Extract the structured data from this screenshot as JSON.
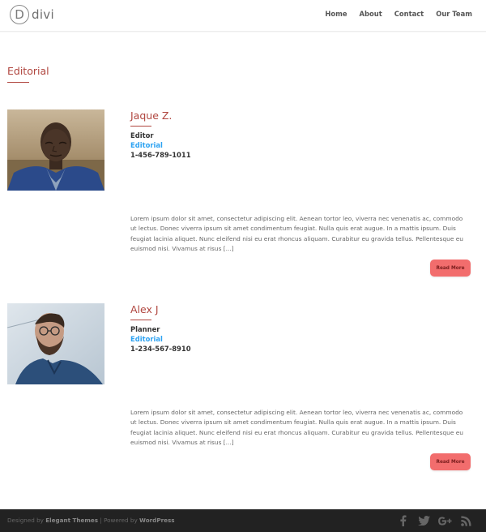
{
  "header": {
    "logo_letter": "D",
    "logo_text": "divi",
    "nav": [
      "Home",
      "About",
      "Contact",
      "Our Team"
    ]
  },
  "section": {
    "title": "Editorial"
  },
  "members": [
    {
      "name": "Jaque Z.",
      "role": "Editor",
      "department": "Editorial",
      "phone": "1-456-789-1011",
      "excerpt": "Lorem ipsum dolor sit amet, consectetur adipiscing elit. Aenean tortor leo, viverra nec venenatis ac, commodo ut lectus. Donec viverra ipsum sit amet condimentum feugiat. Nulla quis erat augue. In a mattis ipsum. Duis feugiat lacinia aliquet. Nunc eleifend nisi eu erat rhoncus aliquam. Curabitur eu gravida tellus. Pellentesque eu euismod nisi. Vivamus at risus [...]",
      "read_more": "Read More"
    },
    {
      "name": "Alex J",
      "role": "Planner",
      "department": "Editorial",
      "phone": "1-234-567-8910",
      "excerpt": "Lorem ipsum dolor sit amet, consectetur adipiscing elit. Aenean tortor leo, viverra nec venenatis ac, commodo ut lectus. Donec viverra ipsum sit amet condimentum feugiat. Nulla quis erat augue. In a mattis ipsum. Duis feugiat lacinia aliquet. Nunc eleifend nisi eu erat rhoncus aliquam. Curabitur eu gravida tellus. Pellentesque eu euismod nisi. Vivamus at risus [...]",
      "read_more": "Read More"
    }
  ],
  "footer": {
    "designed_by": "Designed by",
    "theme_name": "Elegant Themes",
    "separator": "|",
    "powered_by": "Powered by",
    "platform": "WordPress",
    "social_icons": [
      "facebook-icon",
      "twitter-icon",
      "google-plus-icon",
      "rss-icon"
    ]
  },
  "colors": {
    "accent": "#b0463f",
    "link": "#2ea3f2",
    "button": "#f26d6d",
    "footer_bg": "#222222"
  }
}
